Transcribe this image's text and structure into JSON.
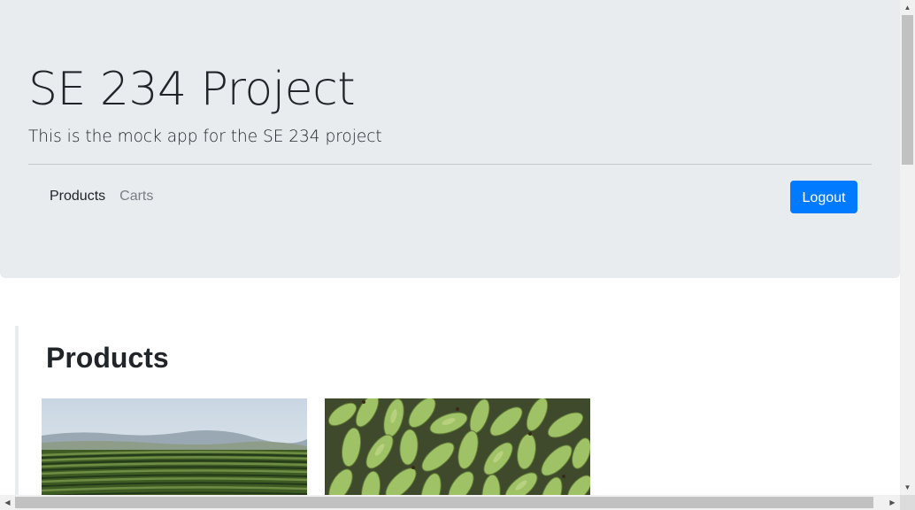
{
  "header": {
    "title": "SE 234 Project",
    "subtitle": "This is the mock app for the SE 234 project"
  },
  "nav": {
    "items": [
      {
        "label": "Products",
        "active": true
      },
      {
        "label": "Carts",
        "active": false
      }
    ],
    "logout_label": "Logout"
  },
  "main": {
    "section_title": "Products",
    "products": [
      {
        "image": "field-rows-image"
      },
      {
        "image": "green-bananas-image"
      }
    ]
  },
  "colors": {
    "jumbotron_bg": "#e9ecef",
    "primary": "#007bff",
    "text": "#212529",
    "muted_link": "#787e84"
  },
  "icons": {
    "scroll_up": "arrow-up-icon",
    "scroll_down": "arrow-down-icon",
    "scroll_left": "arrow-left-icon",
    "scroll_right": "arrow-right-icon"
  }
}
